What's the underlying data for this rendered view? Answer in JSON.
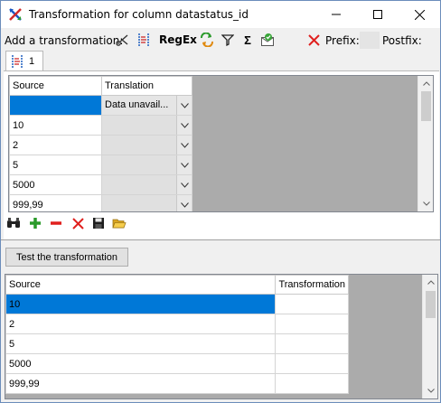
{
  "window": {
    "title": "Transformation for column datastatus_id"
  },
  "toolbar": {
    "add_label": "Add a transformation:",
    "regex_label": "RegEx",
    "sigma_label": "Σ",
    "prefix_label": "Prefix:",
    "postfix_label": "Postfix:",
    "icons": [
      "split-icon",
      "replace-icon",
      "regex",
      "color-replace-icon",
      "filter-icon",
      "sum-icon",
      "calculate-icon"
    ]
  },
  "tab": {
    "label": "1"
  },
  "translation_grid": {
    "columns": [
      "Source",
      "Translation"
    ],
    "rows": [
      {
        "source": "",
        "translation": "Data unavail..."
      },
      {
        "source": "10",
        "translation": ""
      },
      {
        "source": "2",
        "translation": ""
      },
      {
        "source": "5",
        "translation": ""
      },
      {
        "source": "5000",
        "translation": ""
      },
      {
        "source": "999,99",
        "translation": ""
      }
    ]
  },
  "grid_toolbar": {
    "icons": [
      "binoculars-icon",
      "add-icon",
      "remove-icon",
      "delete-icon",
      "save-icon",
      "open-folder-icon"
    ]
  },
  "test_button": {
    "label": "Test the transformation"
  },
  "test_grid": {
    "columns": [
      "Source",
      "Transformation"
    ],
    "rows": [
      {
        "source": "10",
        "transformation": ""
      },
      {
        "source": "2",
        "transformation": ""
      },
      {
        "source": "5",
        "transformation": ""
      },
      {
        "source": "5000",
        "transformation": ""
      },
      {
        "source": "999,99",
        "transformation": ""
      }
    ]
  },
  "colors": {
    "selection": "#0078d7",
    "grid_background": "#ababab",
    "window_background": "#f0f0f0",
    "delete_red": "#e0201e"
  }
}
